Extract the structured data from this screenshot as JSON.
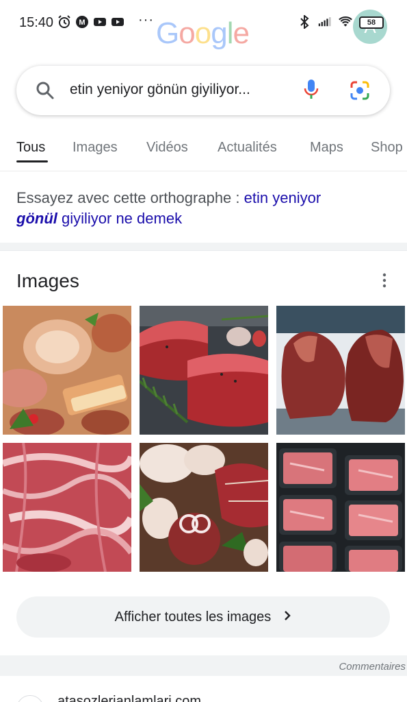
{
  "status_bar": {
    "time": "15:40",
    "dots": "···",
    "battery": "58",
    "left_icons": [
      "alarm-icon",
      "m-app-icon",
      "youtube-icon",
      "youtube-icon"
    ],
    "right_icons": [
      "bluetooth-icon",
      "signal-icon",
      "wifi-icon"
    ]
  },
  "header": {
    "logo_letters": [
      "G",
      "o",
      "o",
      "g",
      "l",
      "e"
    ],
    "avatar_letter": "A",
    "avatar_color": "#a8d8cf"
  },
  "search": {
    "query": "etin yeniyor gönün giyiliyor..."
  },
  "tabs": [
    {
      "label": "Tous",
      "active": true
    },
    {
      "label": "Images",
      "active": false
    },
    {
      "label": "Vidéos",
      "active": false
    },
    {
      "label": "Actualités",
      "active": false
    },
    {
      "label": "Maps",
      "active": false
    },
    {
      "label": "Shop",
      "active": false
    }
  ],
  "spelling": {
    "prefix": "Essayez avec cette orthographe : ",
    "link_part1": "etin yeniyor",
    "link_bold": "gönül",
    "link_part2": " giyiliyor ne demek"
  },
  "images_section": {
    "title": "Images",
    "thumbnails": [
      {
        "name": "sliced-cured-meats"
      },
      {
        "name": "raw-steak-with-herbs"
      },
      {
        "name": "beef-roasts"
      },
      {
        "name": "marbled-raw-meat"
      },
      {
        "name": "raw-chicken-and-beef"
      },
      {
        "name": "packaged-meat-trays"
      }
    ],
    "show_all_label": "Afficher toutes les images"
  },
  "feedback": "Commentaires",
  "next_result": {
    "domain": "atasozlerianlamlari.com"
  },
  "colors": {
    "link": "#1a0dab",
    "muted": "#70757a",
    "chip_bg": "#f1f3f4"
  }
}
